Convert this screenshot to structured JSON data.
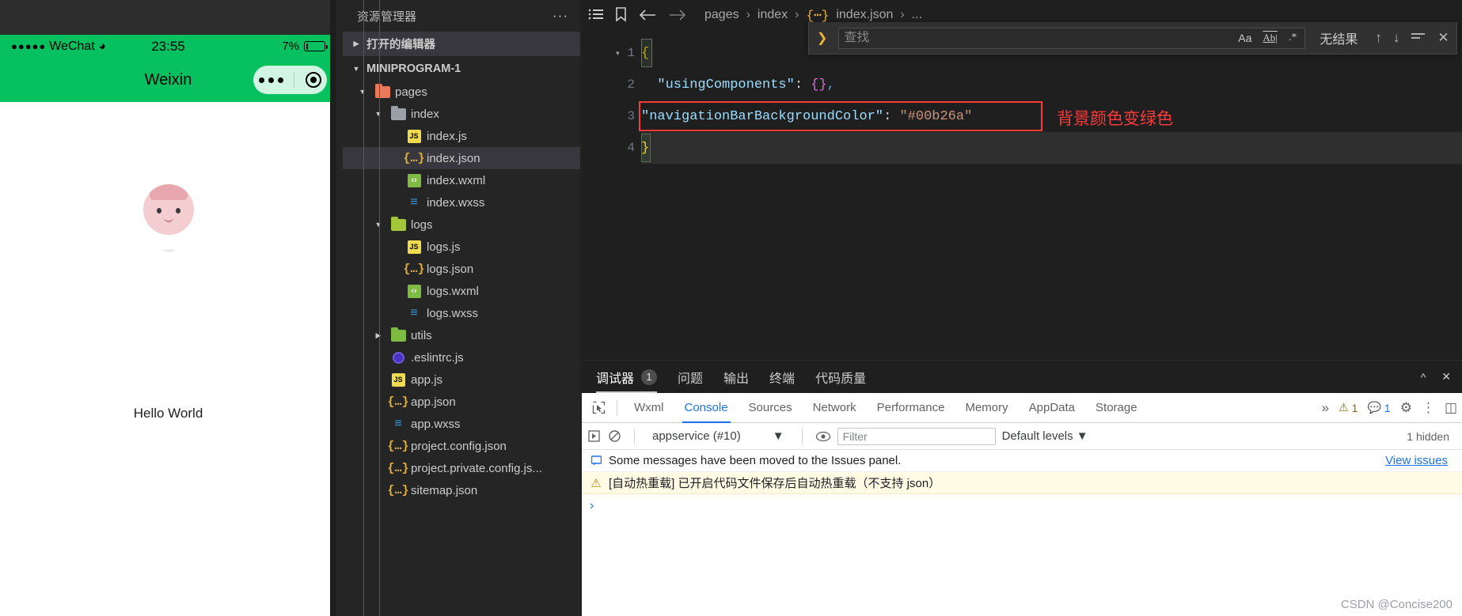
{
  "simulator": {
    "status_bar": {
      "carrier": "WeChat",
      "signal_dots": "●●●●●",
      "wifi_icon": "wifi-icon",
      "time": "23:55",
      "battery_percent": "7%"
    },
    "nav_bar": {
      "title": "Weixin",
      "background_color": "#07c160",
      "capsule": {
        "more_icon": "more-dots-icon",
        "target_icon": "target-circle-icon"
      }
    },
    "page": {
      "avatar": "user-avatar",
      "hello_text": "Hello World"
    }
  },
  "explorer": {
    "title": "资源管理器",
    "more_actions": "···",
    "open_editors_label": "打开的编辑器",
    "project_label": "MINIPROGRAM-1",
    "tree": [
      {
        "label": "pages",
        "icon": "folder-pages-icon",
        "type": "folder",
        "depth": 1,
        "expanded": true
      },
      {
        "label": "index",
        "icon": "folder-icon",
        "type": "folder",
        "depth": 2,
        "expanded": true
      },
      {
        "label": "index.js",
        "icon": "js-file-icon",
        "type": "file",
        "depth": 3
      },
      {
        "label": "index.json",
        "icon": "json-file-icon",
        "type": "file",
        "depth": 3,
        "selected": true
      },
      {
        "label": "index.wxml",
        "icon": "wxml-file-icon",
        "type": "file",
        "depth": 3
      },
      {
        "label": "index.wxss",
        "icon": "wxss-file-icon",
        "type": "file",
        "depth": 3
      },
      {
        "label": "logs",
        "icon": "folder-logs-icon",
        "type": "folder",
        "depth": 2,
        "expanded": true
      },
      {
        "label": "logs.js",
        "icon": "js-file-icon",
        "type": "file",
        "depth": 3
      },
      {
        "label": "logs.json",
        "icon": "json-file-icon",
        "type": "file",
        "depth": 3
      },
      {
        "label": "logs.wxml",
        "icon": "wxml-file-icon",
        "type": "file",
        "depth": 3
      },
      {
        "label": "logs.wxss",
        "icon": "wxss-file-icon",
        "type": "file",
        "depth": 3
      },
      {
        "label": "utils",
        "icon": "folder-utils-icon",
        "type": "folder",
        "depth": 2,
        "expanded": false
      },
      {
        "label": ".eslintrc.js",
        "icon": "eslint-file-icon",
        "type": "file",
        "depth": 2
      },
      {
        "label": "app.js",
        "icon": "js-file-icon",
        "type": "file",
        "depth": 2
      },
      {
        "label": "app.json",
        "icon": "json-file-icon",
        "type": "file",
        "depth": 2
      },
      {
        "label": "app.wxss",
        "icon": "wxss-file-icon",
        "type": "file",
        "depth": 2
      },
      {
        "label": "project.config.json",
        "icon": "json-file-icon",
        "type": "file",
        "depth": 2
      },
      {
        "label": "project.private.config.js...",
        "icon": "json-file-icon",
        "type": "file",
        "depth": 2
      },
      {
        "label": "sitemap.json",
        "icon": "json-file-icon",
        "type": "file",
        "depth": 2
      }
    ]
  },
  "editor": {
    "toolbar_icons": [
      "list-icon",
      "bookmark-icon",
      "arrow-left-icon",
      "arrow-right-icon"
    ],
    "breadcrumb": {
      "segments": [
        "pages",
        "index",
        "index.json",
        "..."
      ],
      "separator": "›",
      "json_icon": "json-file-icon"
    },
    "find": {
      "toggle_icon": "chevron-right-icon",
      "placeholder": "查找",
      "value": "",
      "match_case_label": "Aa",
      "whole_word_label": "Ab|",
      "regex_label": ".*",
      "status": "无结果",
      "prev_icon": "arrow-up-icon",
      "next_icon": "arrow-down-icon",
      "selection_icon": "find-in-selection-icon",
      "close_icon": "close-icon"
    },
    "lines": [
      {
        "number": "1",
        "fold": "chevron-down-icon",
        "content": "{"
      },
      {
        "number": "2",
        "content": "  \"usingComponents\": {},"
      },
      {
        "number": "3",
        "content": "  \"navigationBarBackgroundColor\": \"#00b26a\"",
        "key": "\"navigationBarBackgroundColor\"",
        "value": "\"#00b26a\"",
        "highlighted": true
      },
      {
        "number": "4",
        "content": "}"
      }
    ],
    "annotation": "背景颜色变绿色",
    "annotation_color": "#fb3a3a",
    "highlight_color": "#fb3a3a"
  },
  "devtools": {
    "panel_tabs": [
      {
        "label": "调试器",
        "badge": "1",
        "active": true
      },
      {
        "label": "问题",
        "active": false
      },
      {
        "label": "输出",
        "active": false
      },
      {
        "label": "终端",
        "active": false
      },
      {
        "label": "代码质量",
        "active": false
      }
    ],
    "panel_actions": {
      "collapse_icon": "chevron-up-icon",
      "close_icon": "close-icon"
    },
    "inspect_icon": "inspect-element-icon",
    "tabs": [
      {
        "label": "Wxml",
        "active": false
      },
      {
        "label": "Console",
        "active": true
      },
      {
        "label": "Sources",
        "active": false
      },
      {
        "label": "Network",
        "active": false
      },
      {
        "label": "Performance",
        "active": false
      },
      {
        "label": "Memory",
        "active": false
      },
      {
        "label": "AppData",
        "active": false
      },
      {
        "label": "Storage",
        "active": false
      }
    ],
    "overflow_icon": "double-chevron-right-icon",
    "warning_count": "1",
    "message_count": "1",
    "settings_icon": "gear-icon",
    "more_icon": "vertical-dots-icon",
    "dock_icon": "dock-panel-icon",
    "console_toolbar": {
      "execute_icon": "play-icon",
      "clear_icon": "clear-console-icon",
      "context": "appservice (#10)",
      "context_caret": "▼",
      "eye_icon": "live-expression-icon",
      "filter_placeholder": "Filter",
      "filter_value": "",
      "levels": "Default levels ▼",
      "hidden_count": "1 hidden"
    },
    "messages": [
      {
        "icon": "info-icon",
        "level": "info",
        "text": "Some messages have been moved to the Issues panel.",
        "link": "View issues"
      },
      {
        "icon": "warning-icon",
        "level": "warning",
        "text": "[自动热重载] 已开启代码文件保存后自动热重载（不支持 json）",
        "link": ""
      }
    ],
    "prompt_icon": "›"
  },
  "watermark": "CSDN @Concise200"
}
